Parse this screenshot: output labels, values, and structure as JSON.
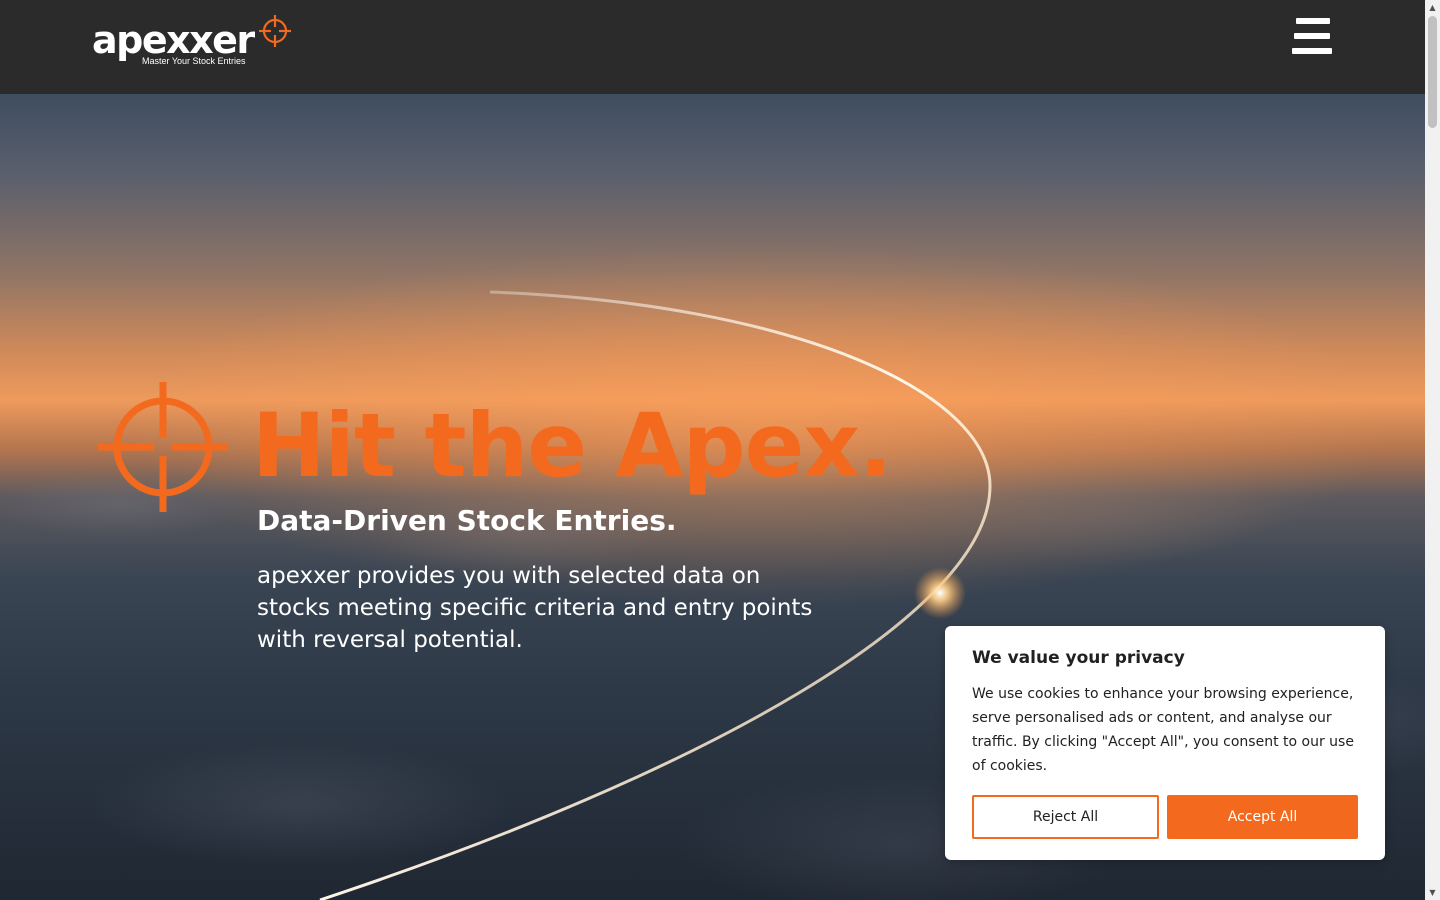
{
  "header": {
    "logo_word": "apexxer",
    "logo_tagline": "Master Your Stock Entries",
    "menu_icon": "hamburger-menu-icon"
  },
  "hero": {
    "title": "Hit the Apex.",
    "subtitle": "Data-Driven Stock Entries.",
    "description": "apexxer provides you with selected data on stocks meeting specific criteria and entry points with reversal potential.",
    "crosshair_icon": "crosshair-icon"
  },
  "cookie_banner": {
    "title": "We value your privacy",
    "text": "We use cookies to enhance your browsing experience, serve personalised ads or content, and analyse our traffic. By clicking \"Accept All\", you consent to our use of cookies.",
    "reject_label": "Reject All",
    "accept_label": "Accept All"
  },
  "colors": {
    "brand_orange": "#f36a1e",
    "header_bg": "#2b2b2b",
    "white": "#ffffff"
  }
}
